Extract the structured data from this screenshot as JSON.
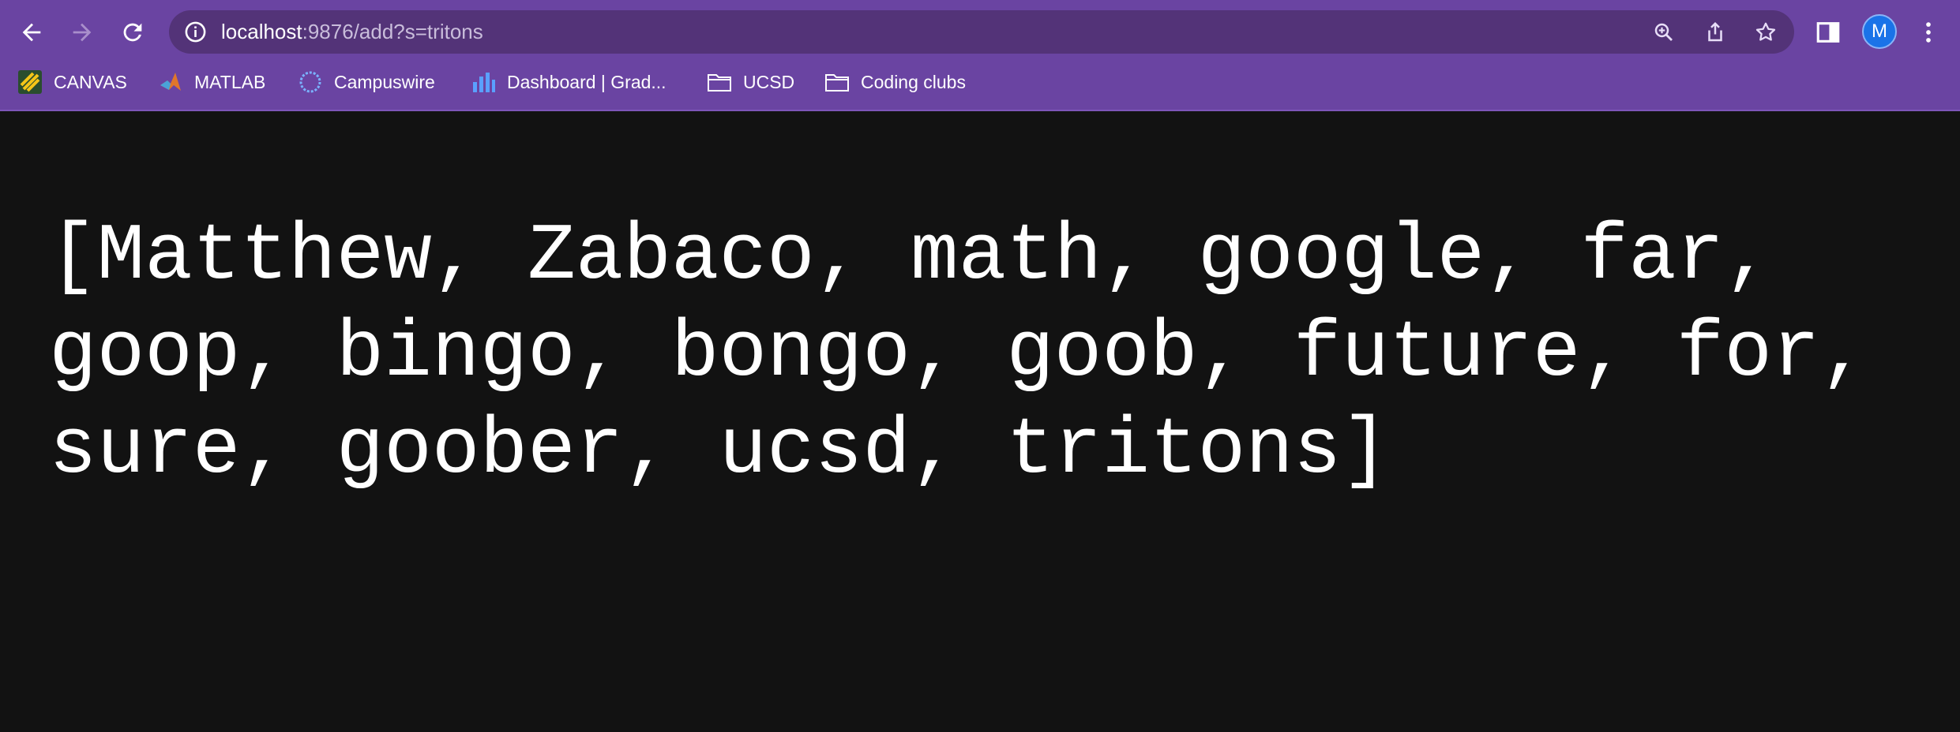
{
  "toolbar": {
    "url_host": "localhost",
    "url_rest": ":9876/add?s=tritons",
    "avatar_initial": "M"
  },
  "bookmarks": [
    {
      "label": "CANVAS",
      "icon": "canvas-icon"
    },
    {
      "label": "MATLAB",
      "icon": "matlab-icon"
    },
    {
      "label": "Campuswire",
      "icon": "campuswire-icon"
    },
    {
      "label": "Dashboard | Grad...",
      "icon": "bar-chart-icon"
    },
    {
      "label": "UCSD",
      "icon": "folder-icon"
    },
    {
      "label": "Coding clubs",
      "icon": "folder-icon"
    }
  ],
  "page": {
    "text": "[Matthew, Zabaco, math, google, far, goop, bingo, bongo, goob, future, for, sure, goober, ucsd, tritons]"
  },
  "colors": {
    "chrome": "#6a44a2",
    "omnibox": "#533378",
    "page_background": "#121212",
    "page_text": "#ffffff"
  }
}
